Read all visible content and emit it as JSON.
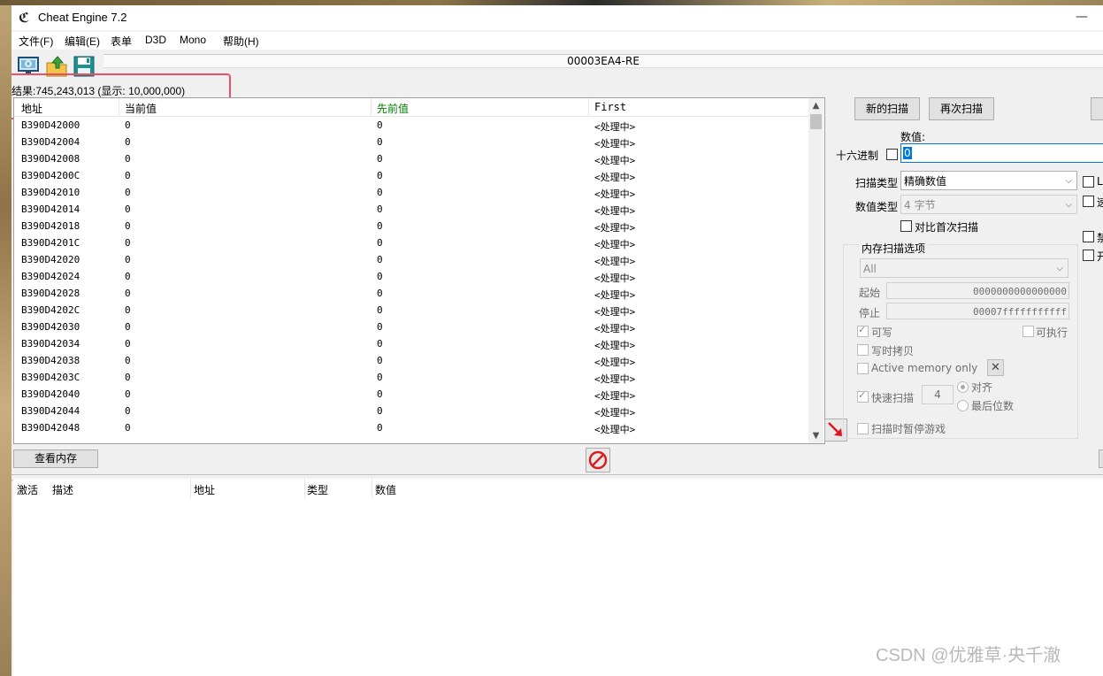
{
  "window": {
    "title": "Cheat Engine 7.2",
    "app_icon": "cheat-engine-icon",
    "minimize": "—"
  },
  "menu": [
    "文件(F)",
    "编辑(E)",
    "表单",
    "D3D",
    "Mono",
    "帮助(H)"
  ],
  "toolbar": {
    "buttons": [
      "open-process-icon",
      "open-file-icon",
      "save-icon"
    ],
    "process_name": "00003EA4-RE"
  },
  "results": {
    "count_text": "结果:745,243,013 (显示: 10,000,000)"
  },
  "scan_list": {
    "columns": [
      "地址",
      "当前值",
      "先前值",
      "First"
    ],
    "previous_color": "#008000",
    "rows": [
      {
        "address": "B390D42000",
        "current": "0",
        "previous": "0",
        "first": "<处理中>"
      },
      {
        "address": "B390D42004",
        "current": "0",
        "previous": "0",
        "first": "<处理中>"
      },
      {
        "address": "B390D42008",
        "current": "0",
        "previous": "0",
        "first": "<处理中>"
      },
      {
        "address": "B390D4200C",
        "current": "0",
        "previous": "0",
        "first": "<处理中>"
      },
      {
        "address": "B390D42010",
        "current": "0",
        "previous": "0",
        "first": "<处理中>"
      },
      {
        "address": "B390D42014",
        "current": "0",
        "previous": "0",
        "first": "<处理中>"
      },
      {
        "address": "B390D42018",
        "current": "0",
        "previous": "0",
        "first": "<处理中>"
      },
      {
        "address": "B390D4201C",
        "current": "0",
        "previous": "0",
        "first": "<处理中>"
      },
      {
        "address": "B390D42020",
        "current": "0",
        "previous": "0",
        "first": "<处理中>"
      },
      {
        "address": "B390D42024",
        "current": "0",
        "previous": "0",
        "first": "<处理中>"
      },
      {
        "address": "B390D42028",
        "current": "0",
        "previous": "0",
        "first": "<处理中>"
      },
      {
        "address": "B390D4202C",
        "current": "0",
        "previous": "0",
        "first": "<处理中>"
      },
      {
        "address": "B390D42030",
        "current": "0",
        "previous": "0",
        "first": "<处理中>"
      },
      {
        "address": "B390D42034",
        "current": "0",
        "previous": "0",
        "first": "<处理中>"
      },
      {
        "address": "B390D42038",
        "current": "0",
        "previous": "0",
        "first": "<处理中>"
      },
      {
        "address": "B390D4203C",
        "current": "0",
        "previous": "0",
        "first": "<处理中>"
      },
      {
        "address": "B390D42040",
        "current": "0",
        "previous": "0",
        "first": "<处理中>"
      },
      {
        "address": "B390D42044",
        "current": "0",
        "previous": "0",
        "first": "<处理中>"
      },
      {
        "address": "B390D42048",
        "current": "0",
        "previous": "0",
        "first": "<处理中>"
      }
    ]
  },
  "scan_panel": {
    "new_scan": "新的扫描",
    "next_scan": "再次扫描",
    "value_label": "数值:",
    "hex_label": "十六进制",
    "value": "0",
    "scan_type_label": "扫描类型",
    "scan_type": "精确数值",
    "value_type_label": "数值类型",
    "value_type": "4 字节",
    "compare_first": "对比首次扫描",
    "right_checks": [
      "Lu",
      "速",
      "禁",
      "开"
    ],
    "mem_group_title": "内存扫描选项",
    "mem_region": "All",
    "start_label": "起始",
    "start_value": "0000000000000000",
    "stop_label": "停止",
    "stop_value": "00007fffffffffff",
    "writable": "可写",
    "executable": "可执行",
    "copy_on_write": "写时拷贝",
    "active_memory": "Active memory only",
    "fast_scan": "快速扫描",
    "fast_scan_value": "4",
    "align": "对齐",
    "last_digits": "最后位数",
    "pause_game": "扫描时暂停游戏"
  },
  "bottom": {
    "view_memory": "查看内存",
    "address_list_columns": [
      "激活",
      "描述",
      "地址",
      "类型",
      "数值"
    ]
  },
  "watermark": "CSDN @优雅草·央千澈"
}
